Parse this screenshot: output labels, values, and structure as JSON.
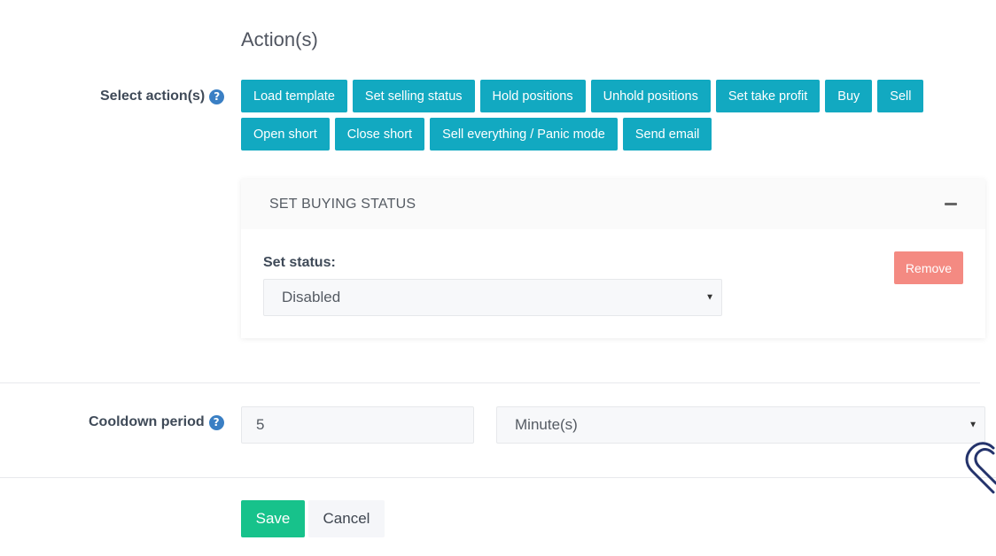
{
  "section": {
    "title": "Action(s)"
  },
  "select_actions": {
    "label": "Select action(s)",
    "help_glyph": "?",
    "buttons": [
      "Load template",
      "Set selling status",
      "Hold positions",
      "Unhold positions",
      "Set take profit",
      "Buy",
      "Sell",
      "Open short",
      "Close short",
      "Sell everything / Panic mode",
      "Send email"
    ]
  },
  "panel": {
    "title": "SET BUYING STATUS",
    "status_label": "Set status:",
    "status_value": "Disabled",
    "remove_label": "Remove"
  },
  "cooldown": {
    "label": "Cooldown period",
    "help_glyph": "?",
    "value": "5",
    "unit": "Minute(s)"
  },
  "footer": {
    "save_label": "Save",
    "cancel_label": "Cancel"
  },
  "colors": {
    "action_button": "#12a9c1",
    "save_button": "#17c28b",
    "remove_button": "#f48a82",
    "help_icon": "#3a7fc4"
  }
}
